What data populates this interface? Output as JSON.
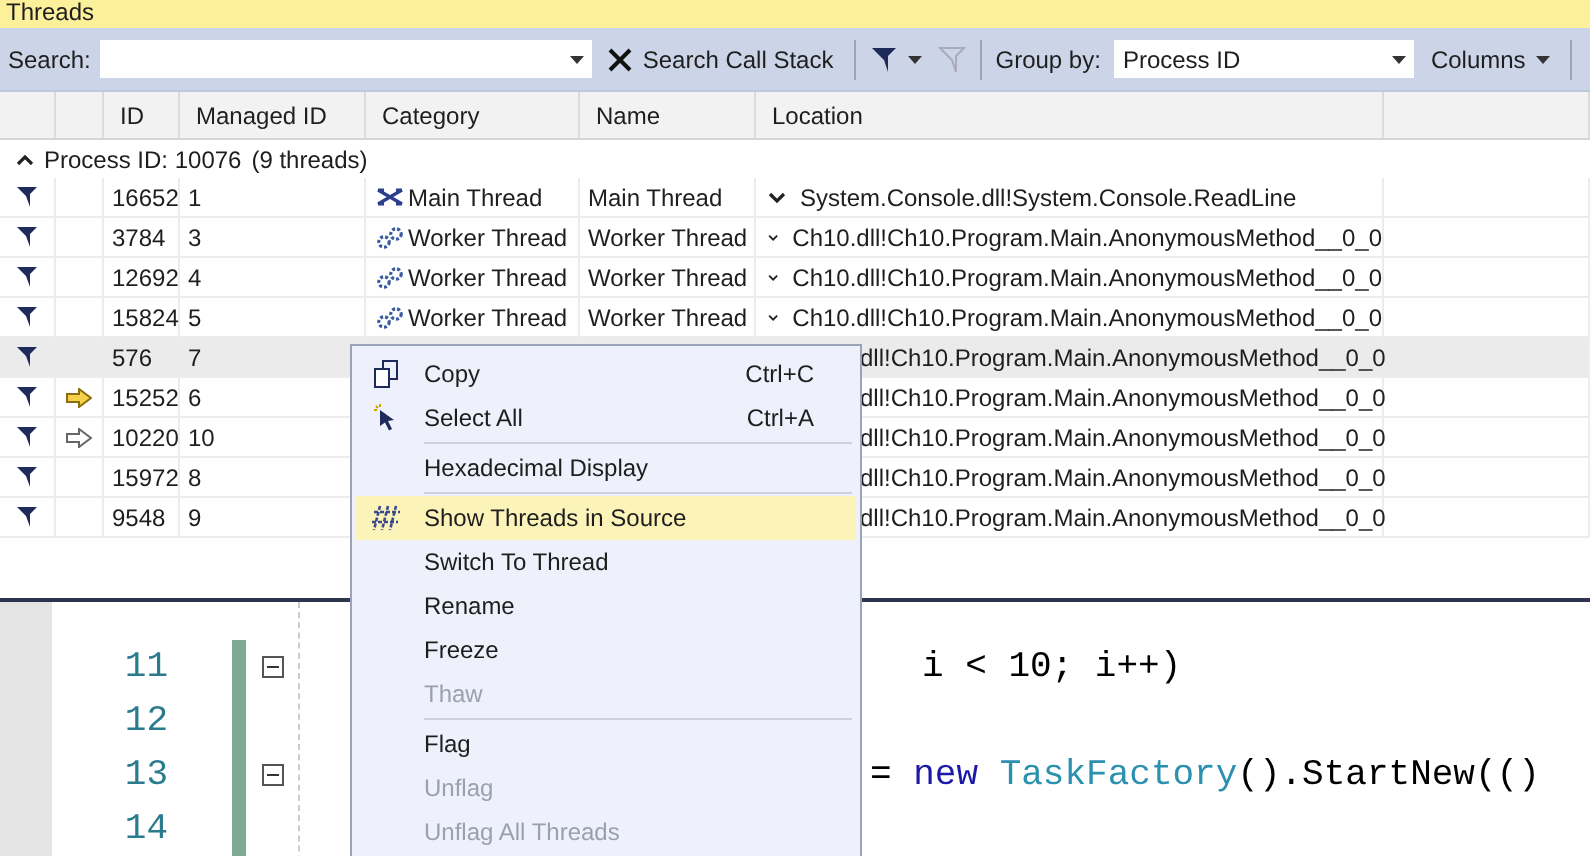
{
  "window": {
    "title": "Threads"
  },
  "toolbar": {
    "search_label": "Search:",
    "search_call_stack": "Search Call Stack",
    "group_by_label": "Group by:",
    "group_by_value": "Process ID",
    "columns_button": "Columns"
  },
  "table": {
    "columns": [
      "ID",
      "Managed ID",
      "Category",
      "Name",
      "Location"
    ],
    "group": {
      "expanded": true,
      "label": "Process ID: 10076",
      "count": "(9 threads)"
    },
    "rows": [
      {
        "flagged": true,
        "id": "16652",
        "managed_id": "1",
        "category": {
          "kind": "main",
          "label": "Main Thread"
        },
        "name": "Main Thread",
        "location": "System.Console.dll!System.Console.ReadLine",
        "selected": false
      },
      {
        "flagged": true,
        "id": "3784",
        "managed_id": "3",
        "category": {
          "kind": "worker",
          "label": "Worker Thread"
        },
        "name": "Worker Thread",
        "location": "Ch10.dll!Ch10.Program.Main.AnonymousMethod__0_0",
        "selected": false
      },
      {
        "flagged": true,
        "id": "12692",
        "managed_id": "4",
        "category": {
          "kind": "worker",
          "label": "Worker Thread"
        },
        "name": "Worker Thread",
        "location": "Ch10.dll!Ch10.Program.Main.AnonymousMethod__0_0",
        "selected": false
      },
      {
        "flagged": true,
        "id": "15824",
        "managed_id": "5",
        "category": {
          "kind": "worker",
          "label": "Worker Thread"
        },
        "name": "Worker Thread",
        "location": "Ch10.dll!Ch10.Program.Main.AnonymousMethod__0_0",
        "selected": false
      },
      {
        "flagged": true,
        "id": "576",
        "managed_id": "7",
        "location": "dll!Ch10.Program.Main.AnonymousMethod__0_0",
        "selected": true
      },
      {
        "flagged": true,
        "marker": {
          "kind": "current"
        },
        "id": "15252",
        "managed_id": "6",
        "location": "dll!Ch10.Program.Main.AnonymousMethod__0_0",
        "selected": false
      },
      {
        "flagged": true,
        "marker": {
          "kind": "other"
        },
        "id": "10220",
        "managed_id": "10",
        "location": "dll!Ch10.Program.Main.AnonymousMethod__0_0",
        "selected": false
      },
      {
        "flagged": true,
        "id": "15972",
        "managed_id": "8",
        "location": "dll!Ch10.Program.Main.AnonymousMethod__0_0",
        "selected": false
      },
      {
        "flagged": true,
        "id": "9548",
        "managed_id": "9",
        "location": "dll!Ch10.Program.Main.AnonymousMethod__0_0",
        "selected": false
      }
    ]
  },
  "editor": {
    "lines": [
      {
        "number": "11",
        "fold": true,
        "tokens": [
          {
            "kind": "plain",
            "text": "i < 10; i++)"
          }
        ]
      },
      {
        "number": "12"
      },
      {
        "number": "13",
        "fold": true,
        "tokens": [
          {
            "kind": "plain",
            "text": "= "
          },
          {
            "kind": "keyword",
            "text": "new "
          },
          {
            "kind": "type",
            "text": "TaskFactory"
          },
          {
            "kind": "plain",
            "text": "().StartNew(()"
          }
        ]
      },
      {
        "number": "14"
      }
    ]
  },
  "context_menu": {
    "items": [
      {
        "kind": "copy",
        "label": "Copy",
        "shortcut": "Ctrl+C",
        "disabled": false,
        "selected": false
      },
      {
        "kind": "select",
        "label": "Select All",
        "shortcut": "Ctrl+A",
        "disabled": false,
        "selected": false
      },
      {
        "kind": "separator"
      },
      {
        "kind": "plain",
        "label": "Hexadecimal Display",
        "disabled": false,
        "selected": false
      },
      {
        "kind": "separator"
      },
      {
        "kind": "threads",
        "label": "Show Threads in Source",
        "disabled": false,
        "selected": true
      },
      {
        "kind": "plain",
        "label": "Switch To Thread",
        "disabled": false,
        "selected": false
      },
      {
        "kind": "plain",
        "label": "Rename",
        "disabled": false,
        "selected": false
      },
      {
        "kind": "plain",
        "label": "Freeze",
        "disabled": false,
        "selected": false
      },
      {
        "kind": "plain",
        "label": "Thaw",
        "disabled": true,
        "selected": false
      },
      {
        "kind": "separator"
      },
      {
        "kind": "plain",
        "label": "Flag",
        "disabled": false,
        "selected": false
      },
      {
        "kind": "plain",
        "label": "Unflag",
        "disabled": true,
        "selected": false
      },
      {
        "kind": "plain",
        "label": "Unflag All Threads",
        "disabled": true,
        "selected": false
      }
    ]
  }
}
